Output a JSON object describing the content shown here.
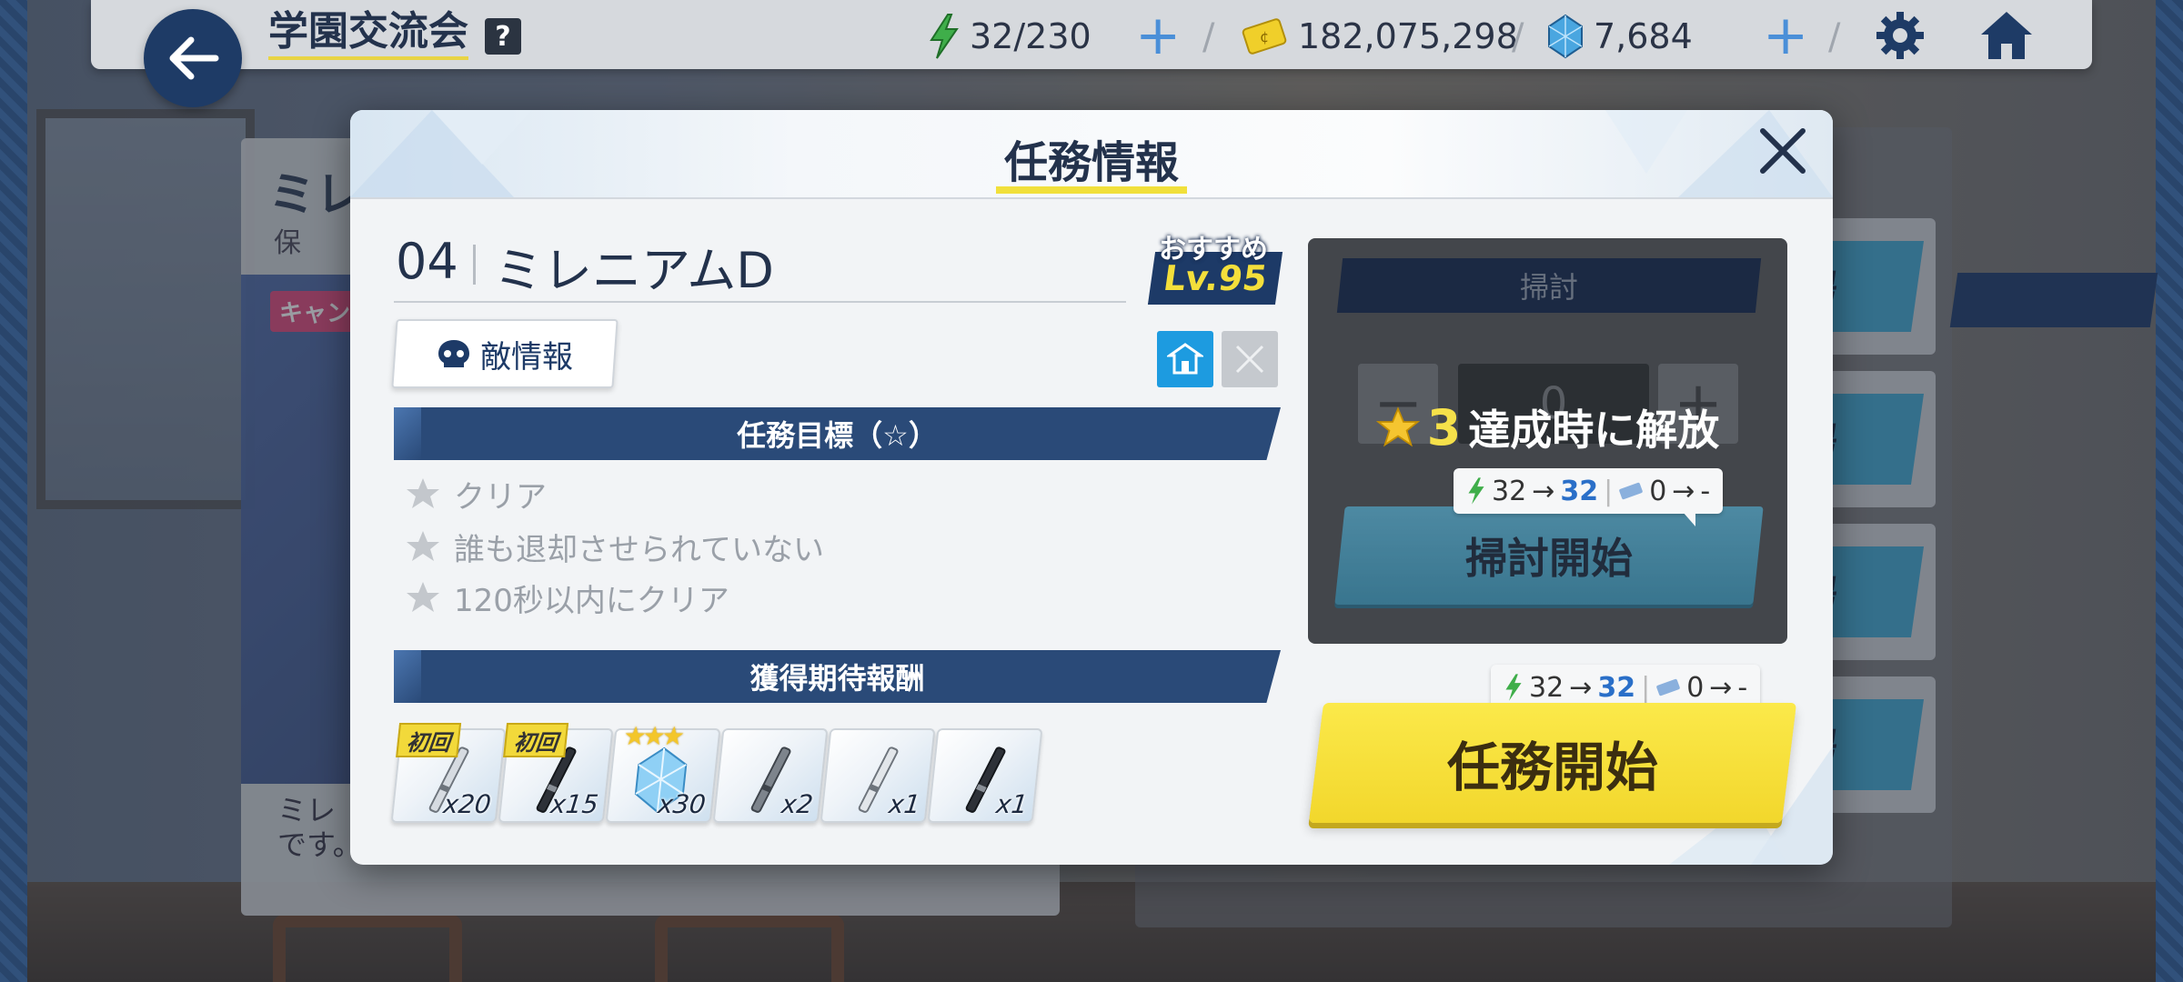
{
  "topbar": {
    "title": "学園交流会",
    "help": "?",
    "ap": "32/230",
    "credits": "182,075,298",
    "pyroxene": "7,684"
  },
  "background": {
    "panel_title": "ミレ",
    "panel_sub": "保",
    "panel_tag": "キャン",
    "panel_desc": [
      "ミレ",
      "です。"
    ],
    "stage_button_label": "場"
  },
  "modal": {
    "title": "任務情報",
    "stage_number": "04",
    "stage_name": "ミレニアムD",
    "recommend_label": "おすすめ",
    "recommend_level": "Lv.95",
    "enemy_info_label": "敵情報",
    "goals_header": "任務目標（☆）",
    "goals": [
      "クリア",
      "誰も退却させられていない",
      "120秒以内にクリア"
    ],
    "rewards_header": "獲得期待報酬",
    "first_clear_label": "初回",
    "rewards": [
      {
        "qty": "x20",
        "first": true,
        "stars": "",
        "kind": "silver"
      },
      {
        "qty": "x15",
        "first": true,
        "stars": "",
        "kind": "dark"
      },
      {
        "qty": "x30",
        "first": false,
        "stars": "★★★",
        "kind": "crystal"
      },
      {
        "qty": "x2",
        "first": false,
        "stars": "",
        "kind": "grey"
      },
      {
        "qty": "x1",
        "first": false,
        "stars": "",
        "kind": "silver"
      },
      {
        "qty": "x1",
        "first": false,
        "stars": "",
        "kind": "dark"
      }
    ]
  },
  "sweep": {
    "title": "掃討",
    "count": "0",
    "minus": "−",
    "plus": "+",
    "unlock_stars": "3",
    "unlock_text": "達成時に解放",
    "cost_ap_from": "32",
    "cost_ap_to": "32",
    "cost_ticket_from": "0",
    "cost_ticket_to": "-",
    "start_label": "掃討開始"
  },
  "mission": {
    "cost_ap_from": "32",
    "cost_ap_to": "32",
    "cost_ticket_from": "0",
    "cost_ticket_to": "-",
    "start_label": "任務開始"
  },
  "colors": {
    "navy": "#23324c",
    "bar": "#2a4a78",
    "yellow": "#f4df3b",
    "blue_accent": "#2a6fc8"
  }
}
